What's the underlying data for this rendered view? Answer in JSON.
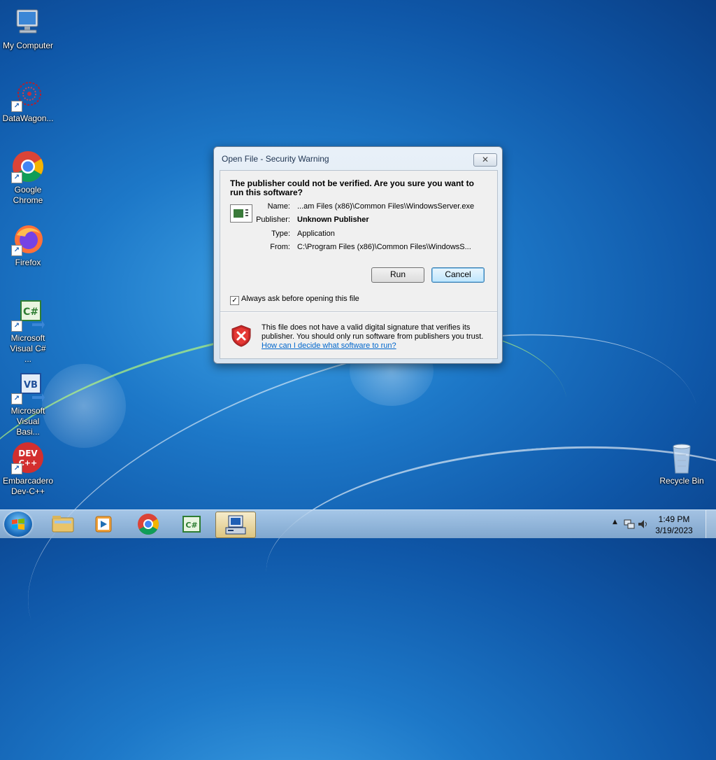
{
  "desktop": {
    "icons": [
      {
        "label": "My Computer"
      },
      {
        "label": "DataWagon..."
      },
      {
        "label": "Google Chrome"
      },
      {
        "label": "Firefox"
      },
      {
        "label": "Microsoft Visual C# ..."
      },
      {
        "label": "Microsoft Visual Basi..."
      },
      {
        "label": "Embarcadero Dev-C++"
      },
      {
        "label": "Recycle Bin"
      }
    ]
  },
  "dialog": {
    "title": "Open File - Security Warning",
    "close_glyph": "✕",
    "headline": "The publisher could not be verified.  Are you sure you want to run this software?",
    "fields": [
      {
        "key": "Name:",
        "value": "...am Files (x86)\\Common Files\\WindowsServer.exe"
      },
      {
        "key": "Publisher:",
        "value": "Unknown Publisher"
      },
      {
        "key": "Type:",
        "value": "Application"
      },
      {
        "key": "From:",
        "value": "C:\\Program Files (x86)\\Common Files\\WindowsS..."
      }
    ],
    "run_label": "Run",
    "cancel_label": "Cancel",
    "checkbox_label": "Always ask before opening this file",
    "checkbox_checked": true,
    "warning_text": "This file does not have a valid digital signature that verifies its publisher.  You should only run software from publishers you trust.",
    "warning_link": "How can I decide what software to run?"
  },
  "taskbar": {
    "time": "1:49 PM",
    "date": "3/19/2023",
    "tray_arrow": "▲"
  }
}
